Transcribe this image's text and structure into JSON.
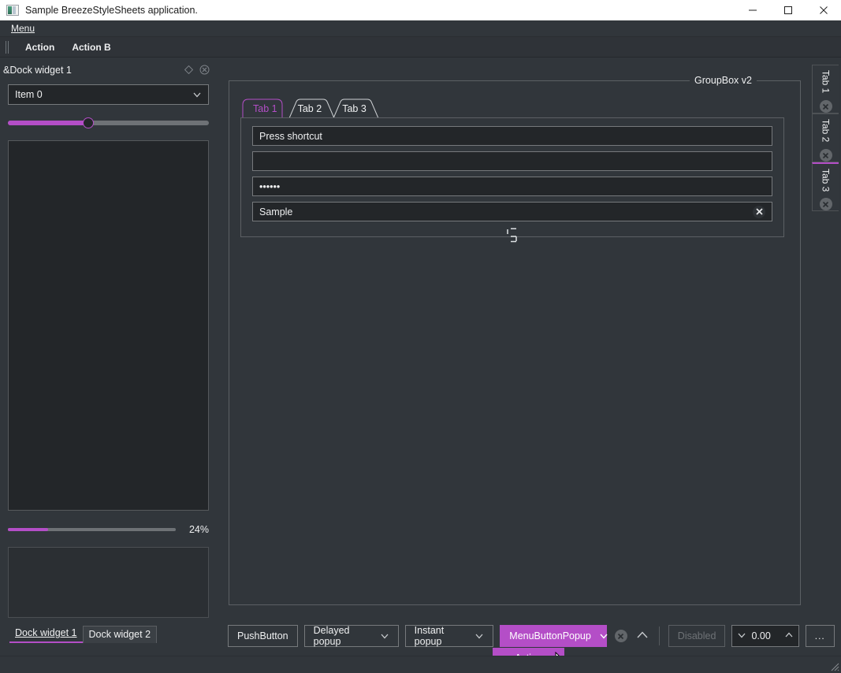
{
  "window": {
    "title": "Sample BreezeStyleSheets application.",
    "app_icon": "picture-icon",
    "minimize_label": "Minimize",
    "maximize_label": "Maximize",
    "close_label": "Close"
  },
  "menubar": {
    "items": [
      {
        "label": "Menu",
        "mnemonic": "M"
      }
    ]
  },
  "toolbar": {
    "handle": "drag-handle",
    "actions": [
      {
        "label": "Action"
      },
      {
        "label": "Action B"
      }
    ]
  },
  "dock": {
    "title": "&Dock widget 1",
    "float_icon": "float-icon",
    "close_icon": "close-icon",
    "combobox": {
      "value": "Item 0",
      "chevron": "chevron-down-icon"
    },
    "slider": {
      "value": 40,
      "min": 0,
      "max": 100
    },
    "progress": {
      "value": 24,
      "label": "24%"
    },
    "tabs": [
      {
        "label": "Dock widget 1",
        "mnemonic": "D",
        "selected": true
      },
      {
        "label": "Dock widget 2",
        "mnemonic": "2",
        "selected": false
      }
    ]
  },
  "main": {
    "groupbox": {
      "title": "GroupBox v2"
    },
    "tabs": [
      {
        "label": "Tab 1",
        "selected": true
      },
      {
        "label": "Tab 2",
        "selected": false
      },
      {
        "label": "Tab 3",
        "selected": false
      }
    ],
    "fields": [
      {
        "name": "shortcut-field",
        "value": "Press shortcut",
        "placeholder": "Press shortcut",
        "type": "keysequence"
      },
      {
        "name": "empty-field",
        "value": "",
        "placeholder": "",
        "type": "text"
      },
      {
        "name": "password-field",
        "value": "••••••",
        "placeholder": "",
        "type": "password"
      },
      {
        "name": "sample-field",
        "value": "Sample",
        "placeholder": "",
        "type": "text",
        "clear_icon": "clear-icon"
      }
    ],
    "lcd": {
      "value": "5",
      "name": "lcd-number"
    }
  },
  "vertical_tabs": [
    {
      "label": "Tab 1",
      "selected": false,
      "close_icon": "close-icon"
    },
    {
      "label": "Tab 2",
      "selected": false,
      "close_icon": "close-icon"
    },
    {
      "label": "Tab 3",
      "selected": true,
      "close_icon": "close-icon"
    }
  ],
  "buttonbar": {
    "pushbutton": "PushButton",
    "delayed_popup": "Delayed popup",
    "instant_popup": "Instant popup",
    "menubutton_popup": "MenuButtonPopup",
    "circle_x_icon": "close-circle-icon",
    "chevron_up_icon": "chevron-up-icon",
    "disabled_button": "Disabled",
    "spinbox": {
      "value": "0.00",
      "down_icon": "chevron-down-icon",
      "up_icon": "chevron-up-icon"
    },
    "dots_button": "..."
  },
  "popup": {
    "action_label": "Action",
    "mnemonic": "A"
  },
  "colors": {
    "background": "#31363b",
    "input_background": "#232629",
    "accent": "#b44ec7",
    "text": "#eff0f1",
    "border": "#76797c",
    "disabled_text": "#6e7276"
  }
}
